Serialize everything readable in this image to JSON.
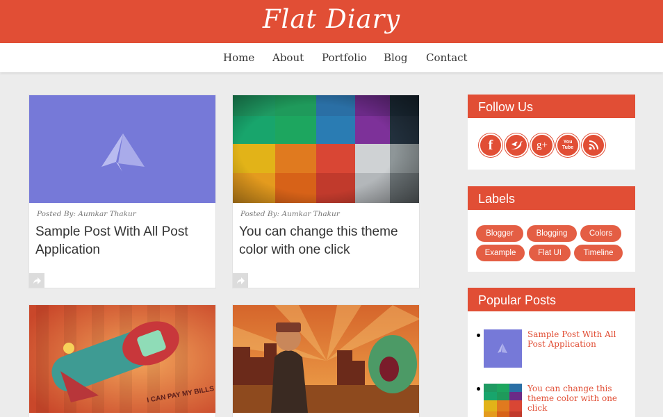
{
  "site": {
    "title": "Flat Diary"
  },
  "nav": {
    "items": [
      "Home",
      "About",
      "Portfolio",
      "Blog",
      "Contact"
    ]
  },
  "posts": [
    {
      "posted_by": "Posted By: Aumkar Thakur",
      "title": "Sample Post With All Post Application"
    },
    {
      "posted_by": "Posted By: Aumkar Thakur",
      "title": "You can change this theme color with one click"
    },
    {
      "image_text": "I CAN PAY MY BILLS"
    }
  ],
  "sidebar": {
    "follow": {
      "title": "Follow Us",
      "icons": [
        "facebook-icon",
        "twitter-icon",
        "google-plus-icon",
        "youtube-icon",
        "rss-icon"
      ],
      "glyphs": [
        "f",
        "t",
        "g+",
        "You Tube",
        ""
      ]
    },
    "labels": {
      "title": "Labels",
      "items": [
        "Blogger",
        "Blogging",
        "Colors",
        "Example",
        "Flat UI",
        "Timeline"
      ]
    },
    "popular": {
      "title": "Popular Posts",
      "items": [
        "Sample Post With All Post Application",
        "You can change this theme color with one click"
      ]
    }
  },
  "colors": {
    "accent": "#e14e35",
    "placeholder": "#7679d8"
  }
}
